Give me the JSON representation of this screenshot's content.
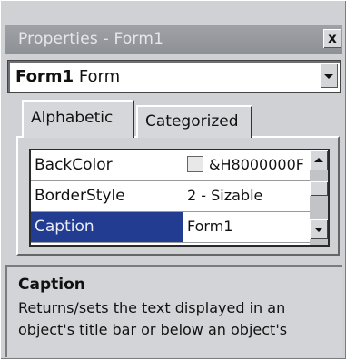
{
  "window": {
    "title": "Properties - Form1",
    "close_label": "x"
  },
  "object_selector": {
    "object_name": "Form1",
    "object_type": "Form"
  },
  "tabs": [
    {
      "label": "Alphabetic",
      "active": true
    },
    {
      "label": "Categorized",
      "active": false
    }
  ],
  "properties": [
    {
      "name": "BackColor",
      "value": "&H8000000F",
      "has_swatch": true
    },
    {
      "name": "BorderStyle",
      "value": "2 - Sizable"
    },
    {
      "name": "Caption",
      "value": "Form1",
      "selected": true
    }
  ],
  "description": {
    "title": "Caption",
    "text": "Returns/sets the text displayed in an object's title bar or below an object's"
  },
  "colors": {
    "selection": "#213c90",
    "title_bar": "#9a9ca1",
    "background": "#cfd1d4"
  }
}
